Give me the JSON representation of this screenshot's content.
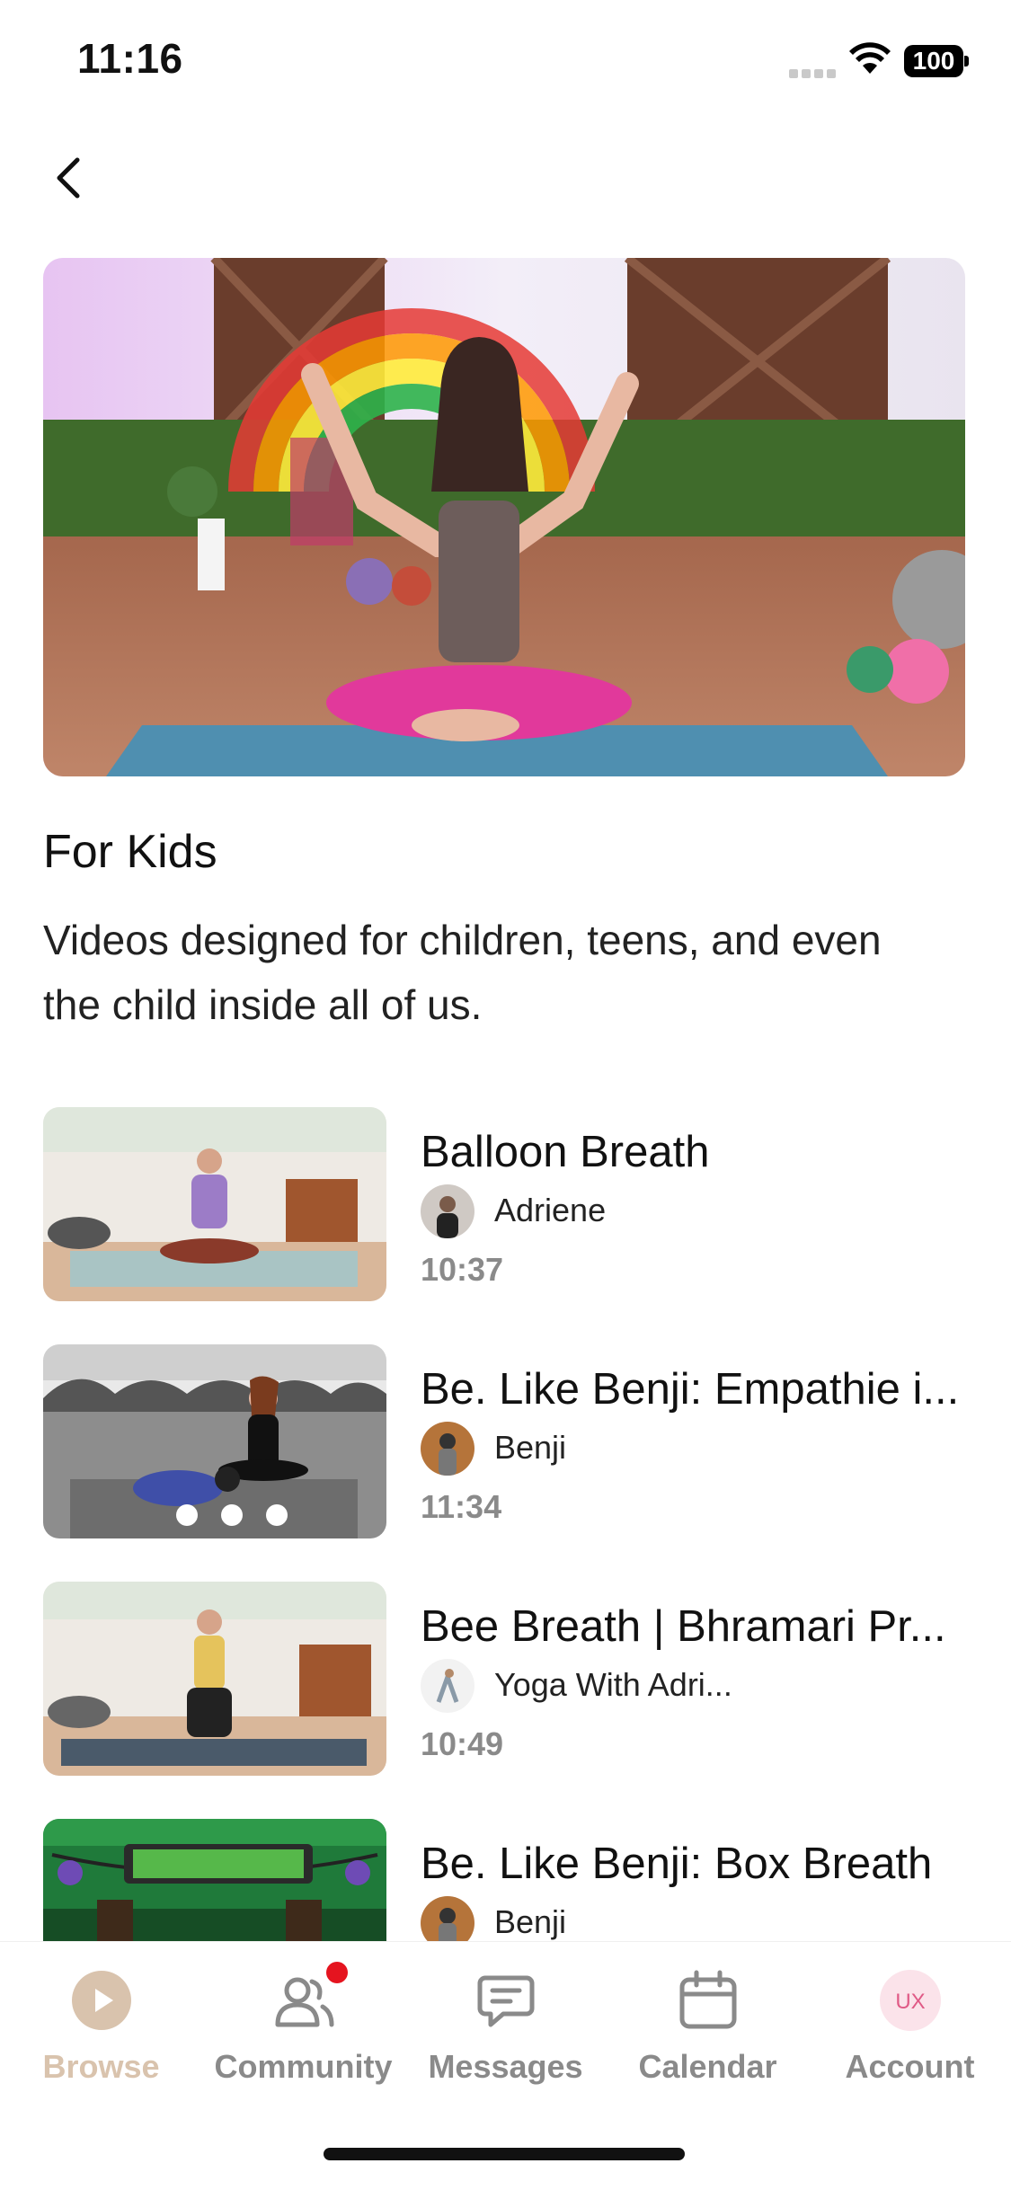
{
  "status": {
    "time": "11:16",
    "battery": "100"
  },
  "section": {
    "title": "For Kids",
    "description": "Videos designed for children, teens, and even the child inside all of us."
  },
  "videos": [
    {
      "title": "Balloon Breath",
      "author": "Adriene",
      "duration": "10:37"
    },
    {
      "title": "Be. Like Benji: Empathie i...",
      "author": "Benji",
      "duration": "11:34"
    },
    {
      "title": "Bee Breath | Bhramari Pr...",
      "author": "Yoga With Adri...",
      "duration": "10:49"
    },
    {
      "title": "Be. Like Benji: Box Breath",
      "author": "Benji",
      "duration": ""
    }
  ],
  "tabs": [
    {
      "label": "Browse",
      "icon": "play-icon",
      "active": true
    },
    {
      "label": "Community",
      "icon": "people-icon",
      "badge": true
    },
    {
      "label": "Messages",
      "icon": "chat-icon"
    },
    {
      "label": "Calendar",
      "icon": "calendar-icon"
    },
    {
      "label": "Account",
      "icon": "avatar-icon",
      "avatar_text": "UX"
    }
  ],
  "colors": {
    "active_tab": "#d9c3ad",
    "inactive_tab": "#8a8a8a",
    "badge": "#e5141f",
    "avatar_bg": "#fbe3ea"
  }
}
